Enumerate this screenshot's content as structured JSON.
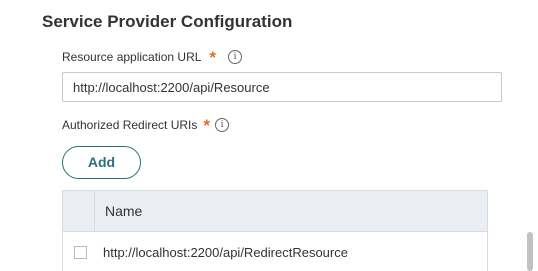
{
  "section": {
    "title": "Service Provider Configuration"
  },
  "resource_url": {
    "label": "Resource application URL",
    "required_marker": "*",
    "info_glyph": "i",
    "value": "http://localhost:2200/api/Resource"
  },
  "redirect_uris": {
    "label": "Authorized Redirect URIs",
    "required_marker": "*",
    "info_glyph": "i",
    "add_button_label": "Add",
    "table": {
      "columns": [
        "Name"
      ],
      "rows": [
        {
          "name": "http://localhost:2200/api/RedirectResource"
        }
      ]
    }
  },
  "colors": {
    "accent": "#2a6f7a",
    "required": "#e46d2a",
    "table_header_bg": "#eaeef3"
  },
  "icons": [
    "info-icon",
    "checkbox"
  ]
}
